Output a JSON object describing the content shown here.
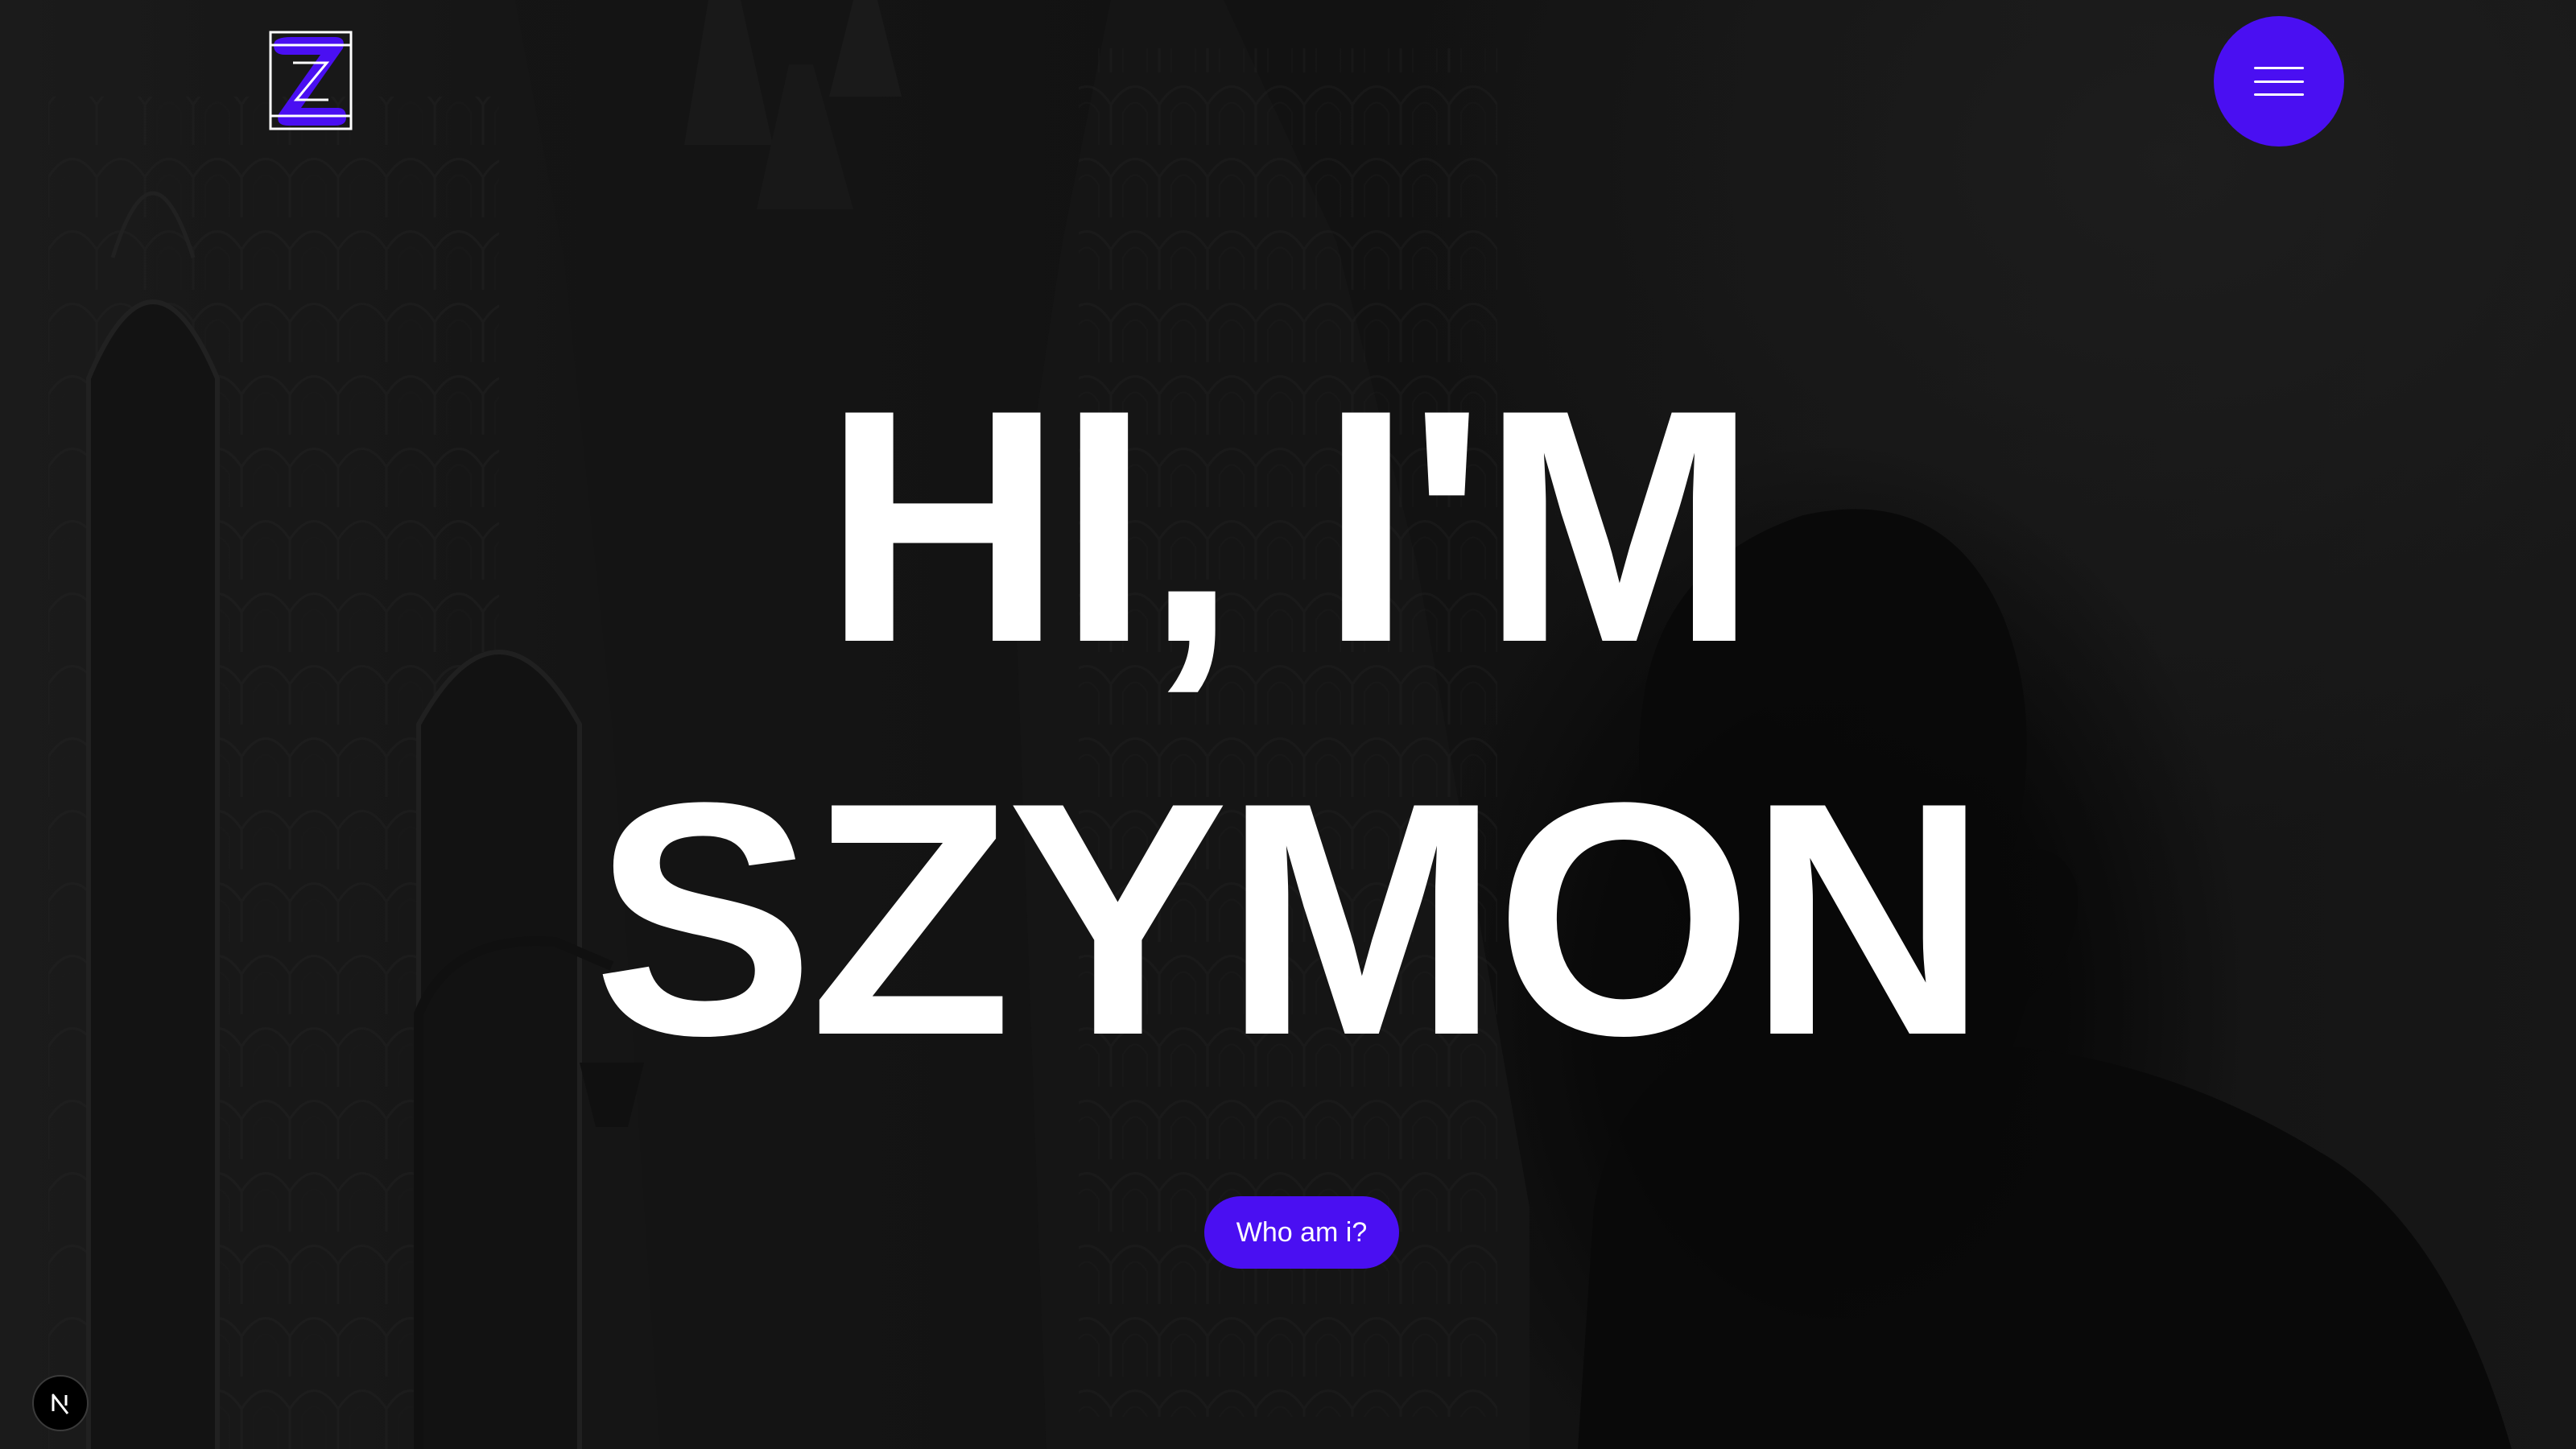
{
  "header": {
    "logo_icon": "z-logo-icon",
    "menu_icon": "hamburger-menu-icon"
  },
  "hero": {
    "headline_line1": "HI, I'M",
    "headline_line2": "SZYMON",
    "cta_label": "Who am i?"
  },
  "dev_badge": {
    "icon": "nextjs-n-icon",
    "glyph": "N"
  },
  "colors": {
    "accent": "#4a0ff2",
    "text": "#ffffff",
    "background": "#151515"
  }
}
